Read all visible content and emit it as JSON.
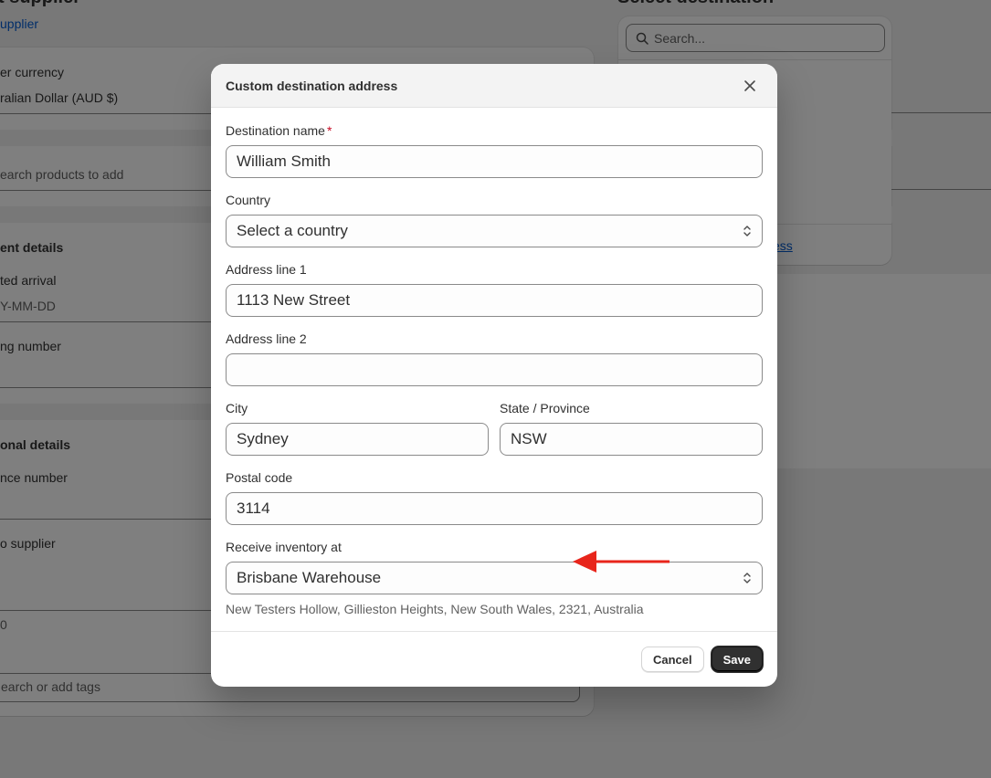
{
  "background": {
    "page_title": "t supplier",
    "supplier_link": "upplier",
    "right_title": "Select destination",
    "search_placeholder": "Search...",
    "right_link": "ess",
    "labels": {
      "currency": "er currency",
      "currency_value": "ralian Dollar (AUD $)",
      "search_products": "earch products to add",
      "shipment_details": "ent details",
      "estimated_arrival": "ted arrival",
      "date_placeholder": "Y-MM-DD",
      "tracking_number": "ng number",
      "additional_details": "onal details",
      "reference_number": "nce number",
      "note_to_supplier": "o supplier",
      "char_count": "0",
      "tags_placeholder": "earch or add tags"
    }
  },
  "modal": {
    "title": "Custom destination address",
    "fields": {
      "destination_name": {
        "label": "Destination name",
        "required_mark": "*",
        "value": "William Smith"
      },
      "country": {
        "label": "Country",
        "value": "Select a country"
      },
      "address1": {
        "label": "Address line 1",
        "value": "1113 New Street"
      },
      "address2": {
        "label": "Address line 2",
        "value": ""
      },
      "city": {
        "label": "City",
        "value": "Sydney"
      },
      "state": {
        "label": "State / Province",
        "value": "NSW"
      },
      "postal": {
        "label": "Postal code",
        "value": "3114"
      },
      "receive_at": {
        "label": "Receive inventory at",
        "value": "Brisbane Warehouse",
        "helper": "New Testers Hollow, Gillieston Heights, New South Wales, 2321, Australia"
      }
    },
    "buttons": {
      "cancel": "Cancel",
      "save": "Save"
    }
  },
  "annotation": {
    "arrow_color": "#e8251b"
  }
}
